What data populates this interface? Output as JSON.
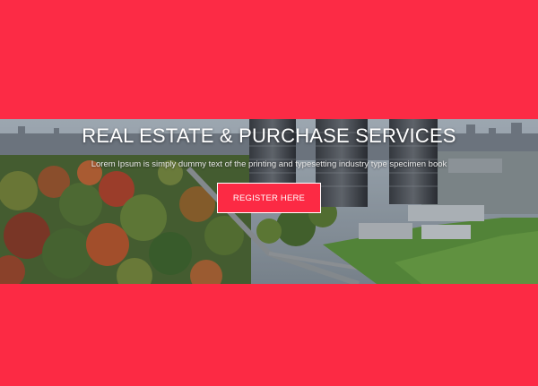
{
  "hero": {
    "title": "REAL ESTATE & PURCHASE SERVICES",
    "subtitle": "Lorem Ipsum is simply dummy text of the printing and typesetting industry type specimen book",
    "register_label": "REGISTER HERE",
    "image_icon": "city-aerial-photo"
  },
  "colors": {
    "brand_red": "#fc2a44",
    "button_border": "#ffffff",
    "title_text": "#ffffff"
  }
}
